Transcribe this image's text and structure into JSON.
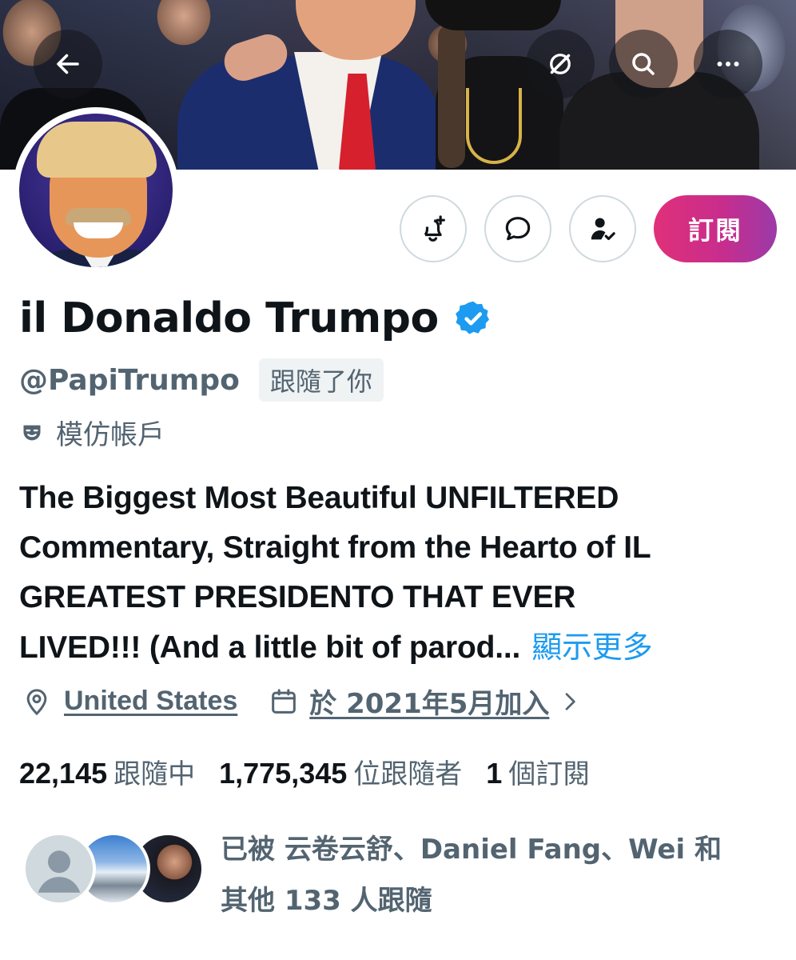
{
  "header": {
    "back_icon": "arrow-left-icon",
    "grok_icon": "grok-icon",
    "search_icon": "search-icon",
    "more_icon": "more-horizontal-icon"
  },
  "actions": {
    "notify_icon": "bell-plus-icon",
    "message_icon": "message-bubble-icon",
    "follow_icon": "person-check-icon",
    "subscribe_label": "訂閱"
  },
  "profile": {
    "display_name": "il Donaldo Trumpo",
    "handle": "@PapiTrumpo",
    "follows_you": "跟隨了你",
    "parody_label": "模仿帳戶",
    "bio_lines": [
      "The Biggest Most Beautiful UNFILTERED",
      "Commentary, Straight from the Hearto of IL",
      "GREATEST PRESIDENTO THAT EVER",
      "LIVED!!! (And a little bit of parod..."
    ],
    "show_more": "顯示更多",
    "location": "United States",
    "joined": "於 2021年5月加入",
    "following_count": "22,145",
    "following_label": "跟隨中",
    "followers_count": "1,775,345",
    "followers_label": "位跟隨者",
    "subscriptions_count": "1",
    "subscriptions_label": "個訂閱",
    "followed_by_line1": "已被 云卷云舒、Daniel Fang、Wei 和",
    "followed_by_line2": "其他 133 人跟隨"
  },
  "colors": {
    "accent": "#1d9bf0",
    "secondary_text": "#536471",
    "subscribe_gradient_start": "#e0307a",
    "subscribe_gradient_end": "#9c3aa8"
  }
}
